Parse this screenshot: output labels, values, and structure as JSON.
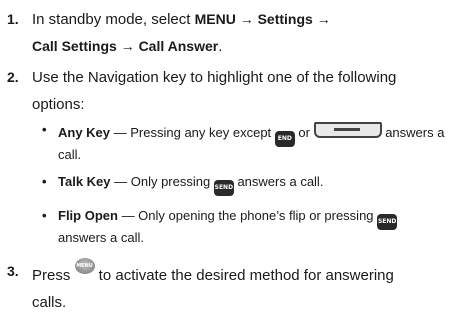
{
  "steps": [
    {
      "number": "1.",
      "line1_prefix": "In standby mode, select ",
      "line1_bold": "MENU → Settings →",
      "line2_bold": "Call Settings → Call Answer",
      "line2_suffix": "."
    },
    {
      "number": "2.",
      "line1": "Use the Navigation key to highlight one of the following",
      "line2": "options:"
    },
    {
      "number": "3.",
      "line1_prefix": "Press ",
      "line1_suffix": " to activate the desired method for answering",
      "line2": "calls."
    }
  ],
  "options": [
    {
      "term": "Any Key",
      "desc_before": " — Pressing any key except ",
      "desc_mid": " or ",
      "desc_after": " answers a",
      "desc_line2": "call."
    },
    {
      "term": "Talk Key",
      "desc_before": " — Only pressing ",
      "desc_after": " answers a call."
    },
    {
      "term": "Flip Open",
      "desc_before": " — Only opening the phone’s flip or pressing ",
      "desc_line2": "answers a call."
    }
  ],
  "keys": {
    "end": "END",
    "send": "SEND",
    "menu": "MENU OK"
  },
  "bullet_glyph": "•",
  "icons": [
    "end-key-icon",
    "navigation-key-icon",
    "send-key-icon",
    "menu-ok-key-icon"
  ]
}
